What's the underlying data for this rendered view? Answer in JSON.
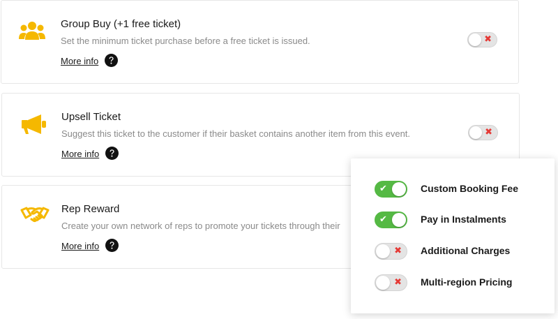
{
  "colors": {
    "accent_yellow": "#f5b800",
    "toggle_on": "#55b944",
    "toggle_off_mark": "#e53935"
  },
  "features": [
    {
      "title": "Group Buy  (+1 free ticket)",
      "description": "Set the minimum ticket purchase before a free ticket is issued.",
      "more_info": "More info",
      "icon": "group-icon",
      "enabled": false
    },
    {
      "title": "Upsell Ticket",
      "description": "Suggest this ticket to the customer if their basket contains another item from this event.",
      "more_info": "More info",
      "icon": "megaphone-icon",
      "enabled": false
    },
    {
      "title": "Rep Reward",
      "description": "Create your own network of reps to promote your tickets through their",
      "more_info": "More info",
      "icon": "handshake-icon",
      "enabled": false
    }
  ],
  "options_panel": {
    "items": [
      {
        "label": "Custom Booking Fee",
        "enabled": true
      },
      {
        "label": "Pay in Instalments",
        "enabled": true
      },
      {
        "label": "Additional Charges",
        "enabled": false
      },
      {
        "label": "Multi-region Pricing",
        "enabled": false
      }
    ]
  }
}
